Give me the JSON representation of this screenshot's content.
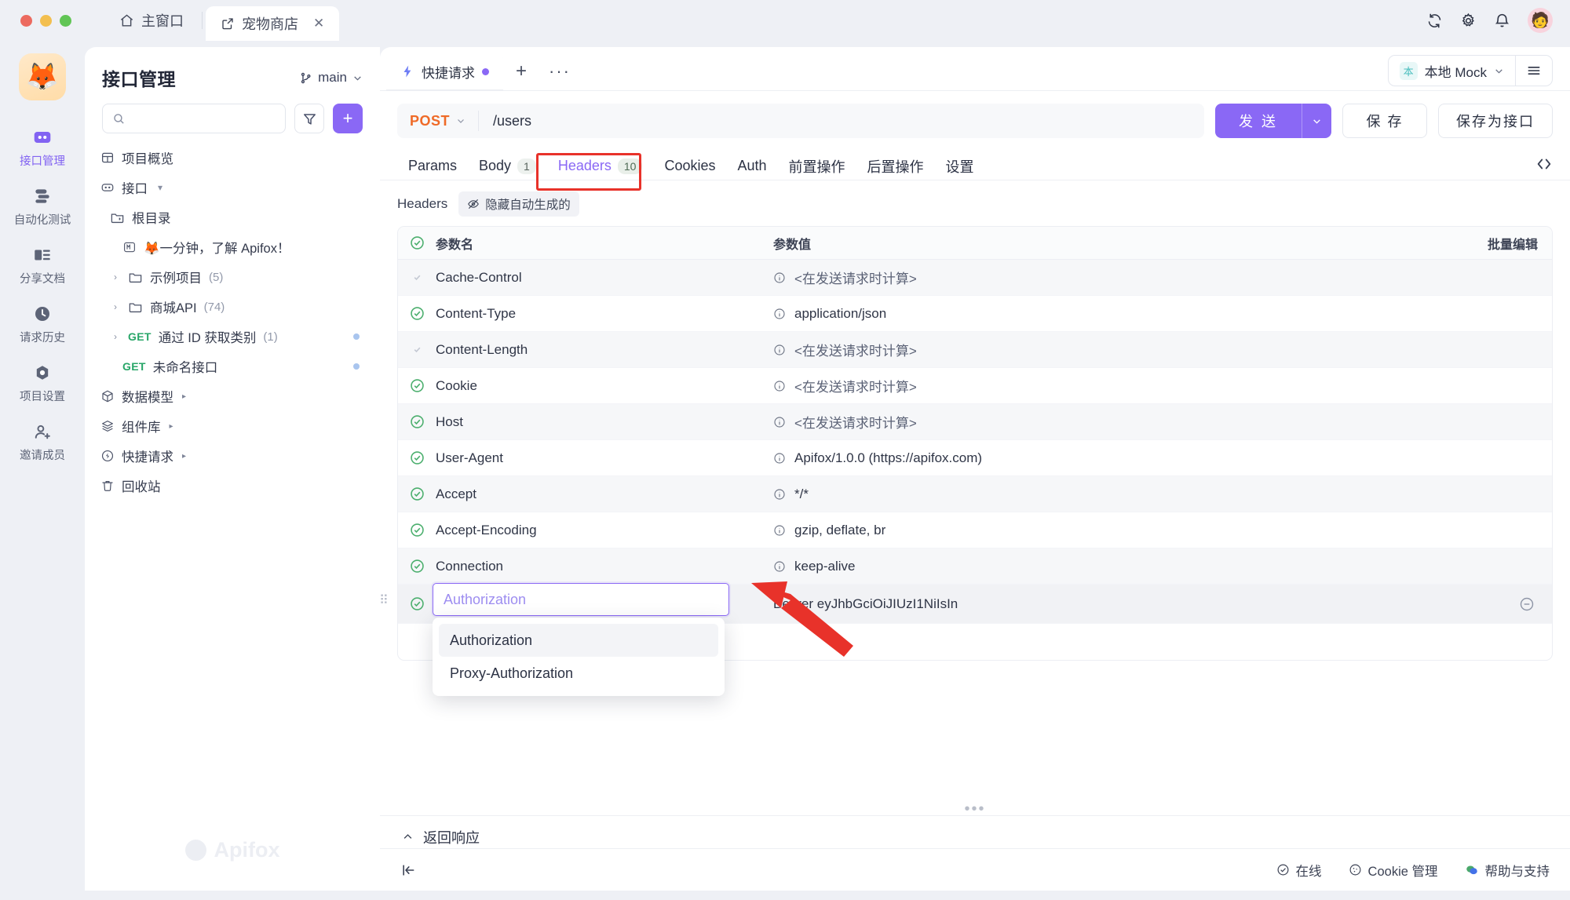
{
  "window": {
    "tabs": [
      {
        "label": "主窗口",
        "icon": "home-icon",
        "active": false,
        "closable": false
      },
      {
        "label": "宠物商店",
        "icon": "external-link-icon",
        "active": true,
        "closable": true
      }
    ],
    "actions": [
      "sync-icon",
      "gear-icon",
      "bell-icon"
    ],
    "avatar": "🧑"
  },
  "rail": {
    "logo": "🦊",
    "items": [
      {
        "label": "接口管理",
        "icon": "api-icon",
        "active": true
      },
      {
        "label": "自动化测试",
        "icon": "flow-icon",
        "active": false
      },
      {
        "label": "分享文档",
        "icon": "book-icon",
        "active": false
      },
      {
        "label": "请求历史",
        "icon": "clock-icon",
        "active": false
      },
      {
        "label": "项目设置",
        "icon": "hex-icon",
        "active": false
      },
      {
        "label": "邀请成员",
        "icon": "user-plus-icon",
        "active": false
      }
    ]
  },
  "panel": {
    "title": "接口管理",
    "branch": "main",
    "search_placeholder": "",
    "filter_icon": "filter-icon",
    "add_label": "+",
    "tree": [
      {
        "label": "项目概览",
        "icon": "overview-icon",
        "level": 0,
        "caret": "",
        "count": "",
        "method": "",
        "dot": false
      },
      {
        "label": "接口",
        "icon": "api-small-icon",
        "level": 0,
        "caret": "▾",
        "count": "",
        "method": "",
        "dot": false
      },
      {
        "label": "根目录",
        "icon": "folder-code-icon",
        "level": 1,
        "caret": "",
        "count": "",
        "method": "",
        "dot": false
      },
      {
        "label": "🦊一分钟，了解 Apifox！",
        "icon": "markdown-icon",
        "level": 2,
        "caret": "",
        "count": "",
        "method": "",
        "dot": false
      },
      {
        "label": "示例项目",
        "icon": "folder-icon",
        "level": 1,
        "caret": "›",
        "count": "(5)",
        "method": "",
        "dot": false
      },
      {
        "label": "商城API",
        "icon": "folder-icon",
        "level": 1,
        "caret": "›",
        "count": "(74)",
        "method": "",
        "dot": false
      },
      {
        "label": "通过 ID 获取类别",
        "icon": "",
        "level": 1,
        "caret": "›",
        "count": "(1)",
        "method": "GET",
        "dot": true
      },
      {
        "label": "未命名接口",
        "icon": "",
        "level": 2,
        "caret": "",
        "count": "",
        "method": "GET",
        "dot": true
      },
      {
        "label": "数据模型",
        "icon": "cube-icon",
        "level": 0,
        "caret": "",
        "count": "",
        "method": "",
        "dot": false,
        "sub_caret": "▸"
      },
      {
        "label": "组件库",
        "icon": "layers-icon",
        "level": 0,
        "caret": "",
        "count": "",
        "method": "",
        "dot": false,
        "sub_caret": "▸"
      },
      {
        "label": "快捷请求",
        "icon": "bolt-icon",
        "level": 0,
        "caret": "",
        "count": "",
        "method": "",
        "dot": false,
        "sub_caret": "▸"
      },
      {
        "label": "回收站",
        "icon": "trash-icon",
        "level": 0,
        "caret": "",
        "count": "",
        "method": "",
        "dot": false
      }
    ],
    "watermark": "Apifox"
  },
  "main": {
    "tabs": [
      {
        "label": "快捷请求",
        "icon": "bolt-icon",
        "active": true,
        "dirty": true
      }
    ],
    "new_tab": "+",
    "more_tabs": "···",
    "mock": {
      "badge": "本",
      "label": "本地 Mock",
      "menu_icon": "hamburger-icon"
    },
    "request": {
      "method": "POST",
      "url": "/users",
      "send_label": "发 送",
      "save_label": "保 存",
      "save_as_label": "保存为接口"
    },
    "section_tabs": [
      {
        "label": "Params",
        "badge": "",
        "active": false
      },
      {
        "label": "Body",
        "badge": "1",
        "active": false
      },
      {
        "label": "Headers",
        "badge": "10",
        "active": true,
        "highlighted": true
      },
      {
        "label": "Cookies",
        "badge": "",
        "active": false
      },
      {
        "label": "Auth",
        "badge": "",
        "active": false
      },
      {
        "label": "前置操作",
        "badge": "",
        "active": false
      },
      {
        "label": "后置操作",
        "badge": "",
        "active": false
      },
      {
        "label": "设置",
        "badge": "",
        "active": false
      }
    ],
    "code_icon": "code-icon",
    "subbar": {
      "label": "Headers",
      "chip_label": "隐藏自动生成的",
      "chip_icon": "eye-off-icon"
    },
    "table": {
      "columns": {
        "name": "参数名",
        "value": "参数值",
        "action": "批量编辑"
      },
      "rows": [
        {
          "name": "Cache-Control",
          "value": "<在发送请求时计算>",
          "checked": "dim",
          "muted": true
        },
        {
          "name": "Content-Type",
          "value": "application/json",
          "checked": "on",
          "muted": false
        },
        {
          "name": "Content-Length",
          "value": "<在发送请求时计算>",
          "checked": "dim",
          "muted": true
        },
        {
          "name": "Cookie",
          "value": "<在发送请求时计算>",
          "checked": "on",
          "muted": true
        },
        {
          "name": "Host",
          "value": "<在发送请求时计算>",
          "checked": "on",
          "muted": true
        },
        {
          "name": "User-Agent",
          "value": "Apifox/1.0.0 (https://apifox.com)",
          "checked": "on",
          "muted": false
        },
        {
          "name": "Accept",
          "value": "*/*",
          "checked": "on",
          "muted": false
        },
        {
          "name": "Accept-Encoding",
          "value": "gzip, deflate, br",
          "checked": "on",
          "muted": false
        },
        {
          "name": "Connection",
          "value": "keep-alive",
          "checked": "on",
          "muted": false
        }
      ],
      "edit_row": {
        "input_value": "Authorization",
        "value": "Bearer eyJhbGciOiJIUzI1NiIsIn",
        "checked": "on",
        "remove_icon": "minus-circle-icon",
        "drag_icon": "drag-handle-icon"
      },
      "suggestions": [
        {
          "label": "Authorization",
          "highlighted": true
        },
        {
          "label": "Proxy-Authorization",
          "highlighted": false
        }
      ]
    },
    "response": {
      "label": "返回响应",
      "caret": "⌃"
    },
    "status": {
      "collapse_icon": "collapse-left-icon",
      "items": [
        {
          "label": "在线",
          "icon": "check-circle-icon"
        },
        {
          "label": "Cookie 管理",
          "icon": "cookie-icon"
        },
        {
          "label": "帮助与支持",
          "icon": "chat-icon"
        }
      ]
    }
  },
  "colors": {
    "accent": "#8a68f5",
    "method_post": "#ef6a27",
    "method_get": "#28a668",
    "annotation": "#e8322a",
    "check_green": "#4caf6e"
  }
}
